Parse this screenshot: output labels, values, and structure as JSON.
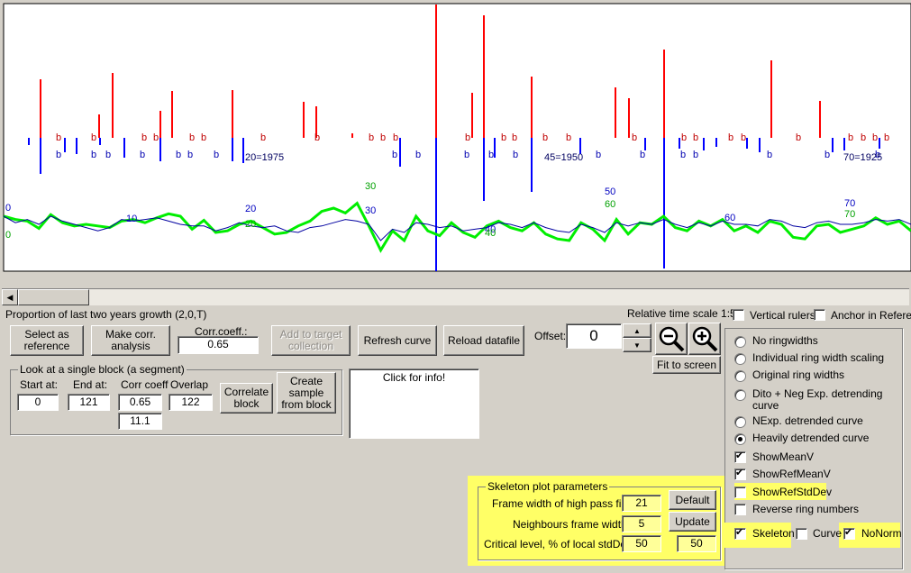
{
  "plot": {
    "tick_labels": [
      {
        "text": "0",
        "color": "#0000c0"
      },
      {
        "text": "0",
        "color": "#00a000"
      },
      {
        "text": "10",
        "color": "#0000c0"
      },
      {
        "text": "20",
        "color": "#0000c0"
      },
      {
        "text": "20",
        "color": "#00a000"
      },
      {
        "text": "30",
        "color": "#00a000"
      },
      {
        "text": "30",
        "color": "#0000c0"
      },
      {
        "text": "40",
        "color": "#0000c0"
      },
      {
        "text": "40",
        "color": "#00a000"
      },
      {
        "text": "50",
        "color": "#0000c0"
      },
      {
        "text": "60",
        "color": "#00a000"
      },
      {
        "text": "60",
        "color": "#0000c0"
      },
      {
        "text": "70",
        "color": "#0000c0"
      },
      {
        "text": "70",
        "color": "#00a000"
      }
    ],
    "year_labels": [
      "20=1975",
      "45=1950",
      "70=1925"
    ],
    "b_marker": "b",
    "colors": {
      "ref": "#ff0000",
      "sample": "#0000ff",
      "sample_curve": "#00ee00",
      "mean_curve": "#0000a0"
    }
  },
  "chart_data": {
    "type": "line",
    "title": "",
    "x_range": [
      0,
      77
    ],
    "series": [
      {
        "values": [
          0,
          -4,
          -6,
          -15,
          2,
          -8,
          -12,
          -10,
          -12,
          -14,
          -6,
          -4,
          -8,
          -2,
          3,
          0,
          -16,
          -5,
          -20,
          -18,
          -10,
          -6,
          -14,
          -22,
          -20,
          -12,
          -6,
          6,
          10,
          4,
          16,
          -12,
          -42,
          -18,
          -30,
          0,
          -18,
          -24,
          -8,
          -20,
          -26,
          -12,
          -6,
          -14,
          -18,
          -8,
          -22,
          -28,
          -30,
          -8,
          -16,
          -30,
          -4,
          -22,
          -8,
          -10,
          0,
          -14,
          -18,
          -6,
          -12,
          -4,
          -18,
          -12,
          -20,
          -6,
          -10,
          -26,
          -28,
          -12,
          -10,
          -20,
          -16,
          -12,
          -2,
          -10,
          -6,
          -18
        ]
      },
      {
        "values": [
          0,
          -8,
          -4,
          -10,
          0,
          -6,
          -10,
          -14,
          -18,
          -14,
          -4,
          -6,
          -4,
          -2,
          -6,
          -10,
          -12,
          -12,
          -18,
          -14,
          -8,
          -12,
          -14,
          -12,
          -18,
          -20,
          -14,
          -12,
          -8,
          -4,
          -6,
          -10,
          -30,
          -16,
          -20,
          -8,
          -10,
          -14,
          -12,
          -18,
          -16,
          -14,
          -8,
          -10,
          -14,
          -8,
          -14,
          -18,
          -20,
          -10,
          -14,
          -20,
          -8,
          -12,
          -8,
          -10,
          -4,
          -10,
          -14,
          -8,
          -12,
          -6,
          -10,
          -10,
          -12,
          -4,
          -6,
          -12,
          -14,
          -8,
          -6,
          -10,
          -10,
          -8,
          -4,
          -6,
          -4,
          -10
        ]
      }
    ]
  },
  "scroll": {
    "left_arrow": "◀"
  },
  "status": {
    "proportion": "Proportion of last two years growth (2,0,T)",
    "time_scale": "Relative time scale 1:5"
  },
  "toolbar": {
    "select_ref": "Select as reference",
    "make_corr": "Make corr. analysis",
    "corr_label": "Corr.coeff.:",
    "corr_value": "0.65",
    "add_target": "Add to target collection",
    "refresh": "Refresh curve",
    "reload": "Reload datafile",
    "offset_label": "Offset:",
    "offset_value": "0",
    "fit": "Fit to screen",
    "up": "▲",
    "down": "▼"
  },
  "checks_top": {
    "vertical": "Vertical rulers",
    "anchor": "Anchor in Reference"
  },
  "block": {
    "title": "Look at a single block (a segment)",
    "start_label": "Start at:",
    "start_value": "0",
    "end_label": "End at:",
    "end_value": "121",
    "corr_label": "Corr coeff",
    "corr_value": "0.65",
    "corr_value2": "11.1",
    "overlap_label": "Overlap",
    "overlap_value": "122",
    "correlate": "Correlate block",
    "create": "Create sample from block"
  },
  "info": {
    "text": "Click for info!"
  },
  "options": {
    "radios": [
      {
        "label": "No ringwidths",
        "checked": false
      },
      {
        "label": "Individual ring width scaling",
        "checked": false
      },
      {
        "label": "Original ring widths",
        "checked": false
      },
      {
        "label": "Dito + Neg Exp. detrending curve",
        "checked": false
      },
      {
        "label": "NExp. detrended curve",
        "checked": false
      },
      {
        "label": "Heavily detrended curve",
        "checked": true
      }
    ],
    "checks": [
      {
        "label": "ShowMeanV",
        "checked": true
      },
      {
        "label": "ShowRefMeanV",
        "checked": true
      },
      {
        "label": "ShowRefStdDev",
        "checked": false
      },
      {
        "label": "Reverse ring numbers",
        "checked": false
      }
    ],
    "skeleton": "Skeleton",
    "curve": "Curve",
    "nonorm": "NoNorm"
  },
  "skeleton": {
    "title": "Skeleton plot parameters",
    "frame_label": "Frame width of high pass filter:",
    "frame_value": "21",
    "neigh_label": "Neighbours frame width:",
    "neigh_value": "5",
    "crit_label": "Critical level, % of local stdDev:",
    "crit_value": "50",
    "crit_value2": "50",
    "default": "Default",
    "update": "Update"
  }
}
